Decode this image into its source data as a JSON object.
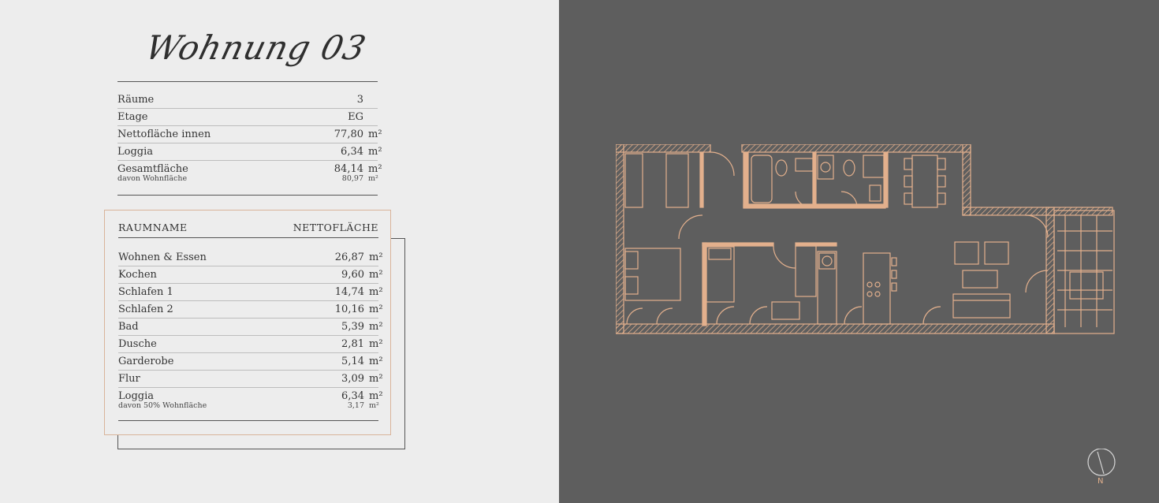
{
  "title": "Wohnung 03",
  "summary": [
    {
      "label": "Räume",
      "value": "3",
      "unit": ""
    },
    {
      "label": "Etage",
      "value": "EG",
      "unit": ""
    },
    {
      "label": "Nettofläche innen",
      "value": "77,80",
      "unit": "m²"
    },
    {
      "label": "Loggia",
      "value": "6,34",
      "unit": "m²"
    }
  ],
  "total": {
    "label": "Gesamtfläche",
    "value": "84,14",
    "unit": "m²",
    "sub_label": "davon Wohnfläche",
    "sub_value": "80,97",
    "sub_unit": "m²"
  },
  "rooms_header": {
    "left": "RAUMNAME",
    "right": "NETTOFLÄCHE"
  },
  "rooms": [
    {
      "label": "Wohnen & Essen",
      "value": "26,87",
      "unit": "m²"
    },
    {
      "label": "Kochen",
      "value": "9,60",
      "unit": "m²"
    },
    {
      "label": "Schlafen 1",
      "value": "14,74",
      "unit": "m²"
    },
    {
      "label": "Schlafen 2",
      "value": "10,16",
      "unit": "m²"
    },
    {
      "label": "Bad",
      "value": "5,39",
      "unit": "m²"
    },
    {
      "label": "Dusche",
      "value": "2,81",
      "unit": "m²"
    },
    {
      "label": "Garderobe",
      "value": "5,14",
      "unit": "m²"
    },
    {
      "label": "Flur",
      "value": "3,09",
      "unit": "m²"
    }
  ],
  "loggia": {
    "label": "Loggia",
    "value": "6,34",
    "unit": "m²",
    "sub_label": "davon 50% Wohnfläche",
    "sub_value": "3,17",
    "sub_unit": "m²"
  },
  "compass_label": "N",
  "colors": {
    "plan_line": "#e3b08d",
    "panel": "#5e5e5e",
    "background": "#ededed",
    "box_border": "#d9b49a"
  }
}
